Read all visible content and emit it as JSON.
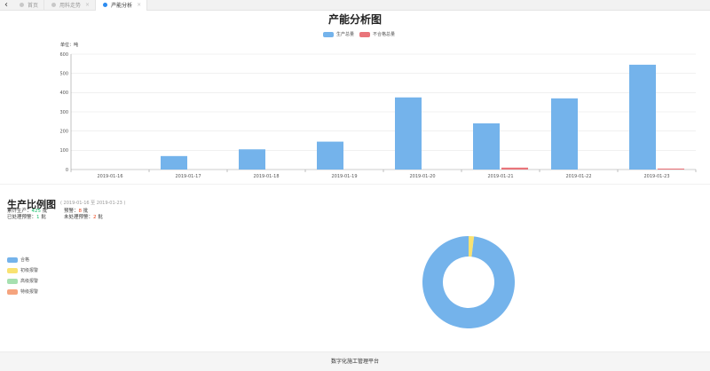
{
  "tabs": [
    {
      "label": "首页",
      "active": false
    },
    {
      "label": "用料走势",
      "active": false
    },
    {
      "label": "产能分析",
      "active": true
    }
  ],
  "colors": {
    "production": "#74b3eb",
    "defect": "#e9747a",
    "qualified": "#74b3eb",
    "warn1": "#f9e271",
    "warn2": "#a6e0b0",
    "warn3": "#f5a47e"
  },
  "chart_data": [
    {
      "type": "bar",
      "title": "产能分析图",
      "ylabel": "单位：吨",
      "xlabel": "",
      "ylim": [
        0,
        600
      ],
      "yticks": [
        0,
        100,
        200,
        300,
        400,
        500,
        600
      ],
      "categories": [
        "2019-01-16",
        "2019-01-17",
        "2019-01-18",
        "2019-01-19",
        "2019-01-20",
        "2019-01-21",
        "2019-01-22",
        "2019-01-23"
      ],
      "series": [
        {
          "name": "生产总量",
          "values": [
            0,
            70,
            105,
            145,
            375,
            240,
            370,
            545
          ]
        },
        {
          "name": "不合格总量",
          "values": [
            0,
            0,
            0,
            0,
            0,
            10,
            0,
            5
          ]
        }
      ],
      "grid": true,
      "legend": "top-center"
    },
    {
      "type": "pie",
      "title": "生产比例图",
      "categories": [
        "合格",
        "初级报警",
        "高级报警",
        "特级报警"
      ],
      "values": [
        417,
        8,
        0,
        0
      ],
      "legend": "left"
    }
  ],
  "proportion": {
    "title": "生产比例图",
    "range": "( 2019-01-16 至 2019-01-23 )",
    "total_label": "累计生产：",
    "total_value": "425",
    "total_unit": "批",
    "warn_label": "预警：",
    "warn_value": "8",
    "warn_unit": "批",
    "handled_label": "已处理预警：",
    "handled_value": "1",
    "handled_unit": "批",
    "unhandled_label": "未处理预警：",
    "unhandled_value": "2",
    "unhandled_unit": "批"
  },
  "footer": "数字化施工管理平台"
}
